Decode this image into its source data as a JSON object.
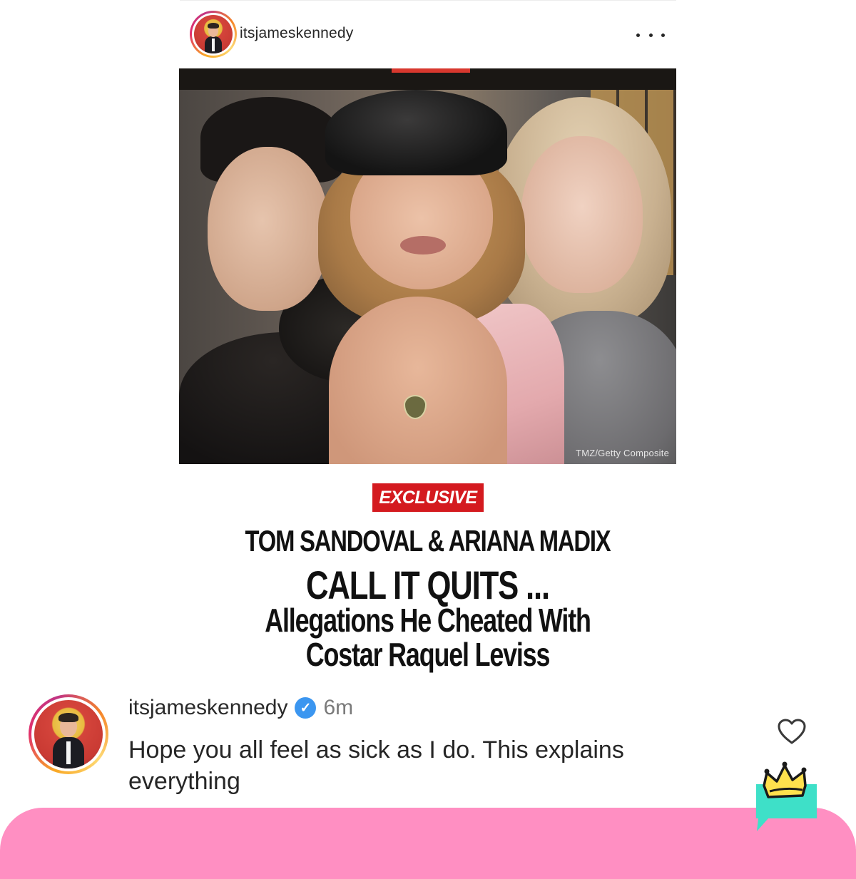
{
  "post": {
    "username": "itsjameskennedy",
    "more_icon": "more-horizontal-icon"
  },
  "image": {
    "credit": "TMZ/Getty Composite",
    "badge": "EXCLUSIVE",
    "headline_line1": "TOM SANDOVAL & ARIANA MADIX",
    "headline_line2": "CALL IT QUITS ...",
    "headline_line3": "Allegations He Cheated With",
    "headline_line4": "Costar Raquel Leviss"
  },
  "comment": {
    "username": "itsjameskennedy",
    "time": "6m",
    "text": "Hope you all feel as sick as I do. This explains everything",
    "verified_icon": "verified-badge-icon",
    "like_icon": "heart-icon"
  },
  "colors": {
    "badge_red": "#d41a1f",
    "bottom_bar_pink": "#ff8fc2",
    "verified_blue": "#3b96f0",
    "crown_yellow": "#ffe14d",
    "crown_teal": "#3ee0c8"
  }
}
